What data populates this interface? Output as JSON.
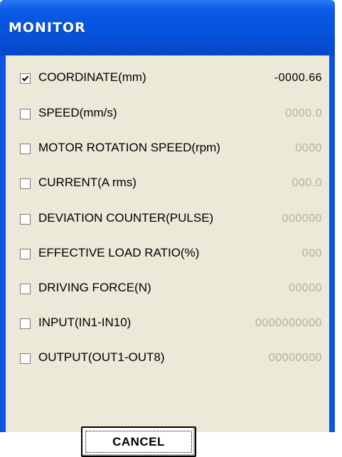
{
  "window": {
    "title": "MONITOR"
  },
  "rows": [
    {
      "label": "COORDINATE(mm)",
      "value": "-0000.66",
      "checked": true
    },
    {
      "label": "SPEED(mm/s)",
      "value": "0000.0",
      "checked": false
    },
    {
      "label": "MOTOR ROTATION SPEED(rpm)",
      "value": "0000",
      "checked": false
    },
    {
      "label": "CURRENT(A rms)",
      "value": "000.0",
      "checked": false
    },
    {
      "label": "DEVIATION COUNTER(PULSE)",
      "value": "000000",
      "checked": false
    },
    {
      "label": "EFFECTIVE LOAD RATIO(%)",
      "value": "000",
      "checked": false
    },
    {
      "label": "DRIVING FORCE(N)",
      "value": "00000",
      "checked": false
    },
    {
      "label": "INPUT(IN1-IN10)",
      "value": "0000000000",
      "checked": false
    },
    {
      "label": "OUTPUT(OUT1-OUT8)",
      "value": "00000000",
      "checked": false
    }
  ],
  "buttons": {
    "cancel": "CANCEL"
  },
  "colors": {
    "titlebar": "#0653dc",
    "client": "#ece9d8",
    "inactive_value": "#b4b0a2"
  }
}
